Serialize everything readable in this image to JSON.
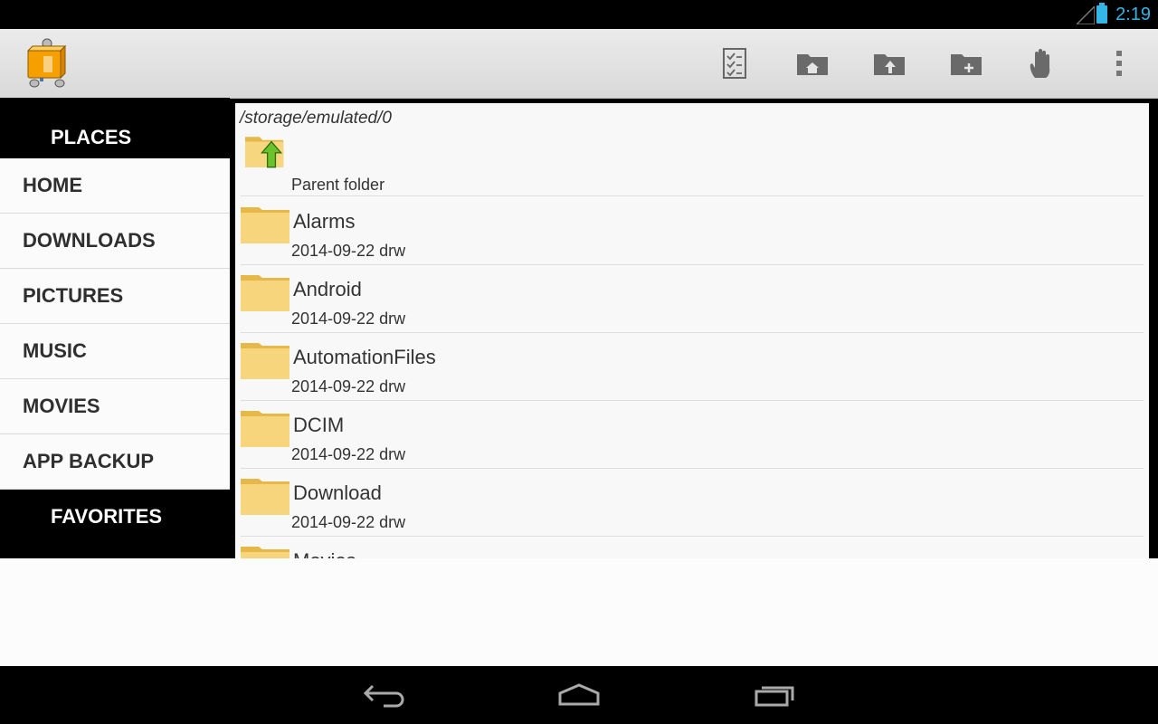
{
  "status_bar": {
    "time": "2:19",
    "signal_icon": "signal-icon",
    "battery_icon": "battery-icon"
  },
  "action_bar": {
    "app_icon": "file-manager-app-icon",
    "actions": [
      {
        "name": "multi-select-button",
        "icon": "checklist-icon"
      },
      {
        "name": "home-folder-button",
        "icon": "folder-home-icon"
      },
      {
        "name": "up-folder-button",
        "icon": "folder-up-icon"
      },
      {
        "name": "new-folder-button",
        "icon": "folder-add-icon"
      },
      {
        "name": "hand-button",
        "icon": "hand-icon"
      },
      {
        "name": "overflow-menu-button",
        "icon": "more-vert-icon"
      }
    ]
  },
  "sidebar": {
    "places_header": "PLACES",
    "items": [
      {
        "label": "HOME"
      },
      {
        "label": "DOWNLOADS"
      },
      {
        "label": "PICTURES"
      },
      {
        "label": "MUSIC"
      },
      {
        "label": "MOVIES"
      },
      {
        "label": "APP BACKUP"
      }
    ],
    "favorites_header": "FAVORITES"
  },
  "main": {
    "path": "/storage/emulated/0",
    "parent_label": "Parent folder",
    "rows": [
      {
        "name": "Alarms",
        "meta": "2014-09-22 drw"
      },
      {
        "name": "Android",
        "meta": "2014-09-22 drw"
      },
      {
        "name": "AutomationFiles",
        "meta": "2014-09-22 drw"
      },
      {
        "name": "DCIM",
        "meta": "2014-09-22 drw"
      },
      {
        "name": "Download",
        "meta": "2014-09-22 drw"
      },
      {
        "name": "Movies",
        "meta": ""
      }
    ]
  },
  "nav_bar": {
    "back_icon": "back-icon",
    "home_icon": "home-icon",
    "recents_icon": "recents-icon"
  },
  "colors": {
    "accent": "#33b5e5",
    "folder": "#f0c860"
  }
}
